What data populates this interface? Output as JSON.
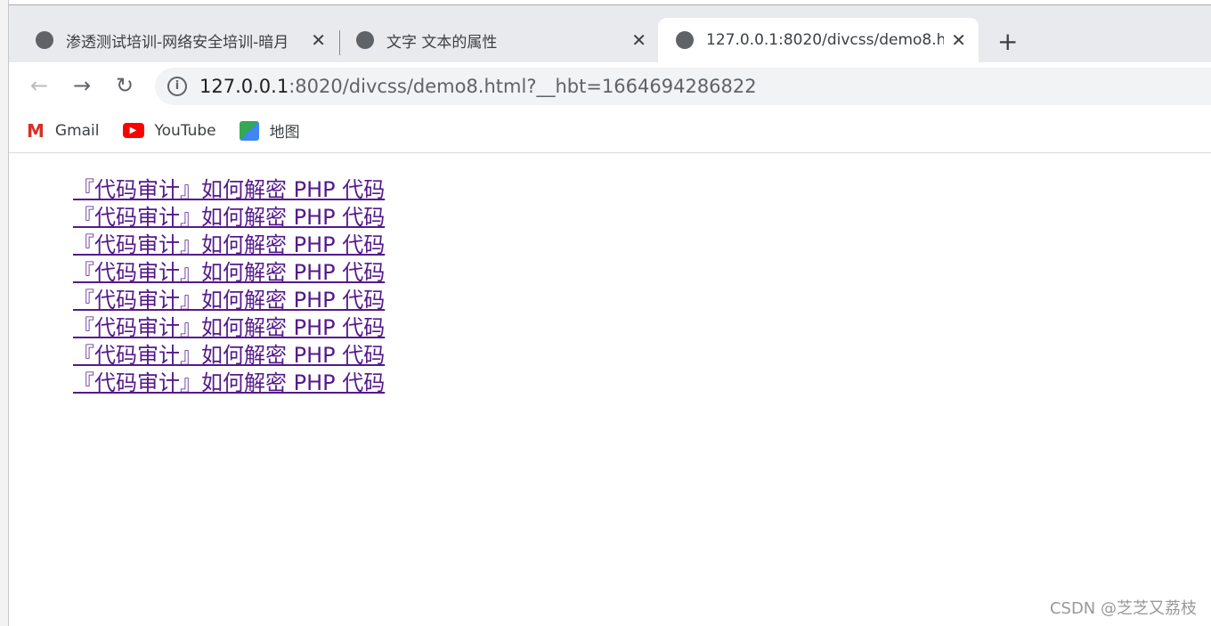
{
  "tabs": [
    {
      "title": "渗透测试培训-网络安全培训-暗月",
      "active": false
    },
    {
      "title": "文字 文本的属性",
      "active": false
    },
    {
      "title": "127.0.0.1:8020/divcss/demo8.h",
      "active": true
    }
  ],
  "address": {
    "host": "127.0.0.1",
    "rest": ":8020/divcss/demo8.html?__hbt=1664694286822"
  },
  "bookmarks": [
    {
      "label": "Gmail"
    },
    {
      "label": "YouTube"
    },
    {
      "label": "地图"
    }
  ],
  "links": [
    "『代码审计』如何解密 PHP 代码",
    "『代码审计』如何解密 PHP 代码",
    "『代码审计』如何解密 PHP 代码",
    "『代码审计』如何解密 PHP 代码",
    "『代码审计』如何解密 PHP 代码",
    "『代码审计』如何解密 PHP 代码",
    "『代码审计』如何解密 PHP 代码",
    "『代码审计』如何解密 PHP 代码"
  ],
  "watermark": "CSDN @芝芝又荔枝",
  "colors": {
    "visited_link": "#551a8b"
  }
}
